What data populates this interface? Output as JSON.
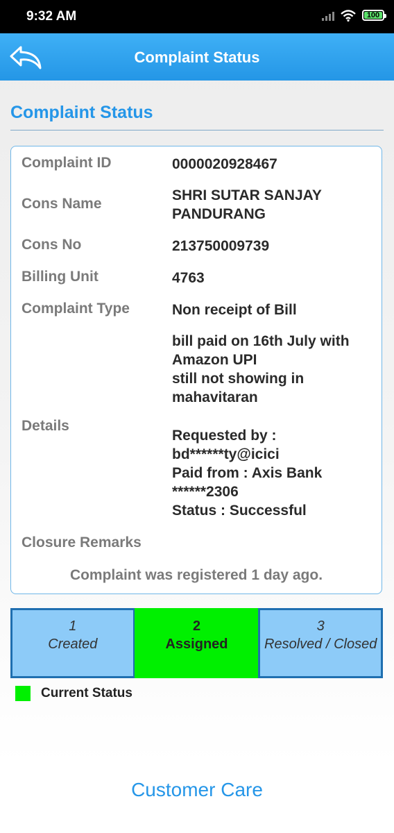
{
  "status_bar": {
    "time": "9:32 AM",
    "battery": "100"
  },
  "app_bar": {
    "title": "Complaint Status",
    "back_icon": "back-arrow-icon"
  },
  "section": {
    "title": "Complaint Status"
  },
  "details": {
    "complaint_id_label": "Complaint ID",
    "complaint_id_value": "0000020928467",
    "cons_name_label": "Cons Name",
    "cons_name_value_line1": "SHRI SUTAR SANJAY",
    "cons_name_value_line2": "PANDURANG",
    "cons_no_label": "Cons No",
    "cons_no_value": "213750009739",
    "billing_unit_label": "Billing Unit",
    "billing_unit_value": "4763",
    "complaint_type_label": "Complaint Type",
    "complaint_type_value": "Non receipt of Bill",
    "details_label": "Details",
    "details_lines": [
      "bill paid on 16th July with",
      "Amazon UPI",
      "still not showing in",
      "mahavitaran",
      "Requested by :",
      "bd******ty@icici",
      "Paid from : Axis Bank",
      "******2306",
      "Status : Successful"
    ],
    "closure_remarks_label": "Closure Remarks",
    "registered_note": "Complaint was registered 1 day ago."
  },
  "progress": {
    "steps": [
      {
        "number": "1",
        "label": "Created"
      },
      {
        "number": "2",
        "label": "Assigned"
      },
      {
        "number": "3",
        "label": "Resolved / Closed"
      }
    ],
    "current_step": 2,
    "legend_label": "Current Status"
  },
  "colors": {
    "accent": "#2596e8",
    "current": "#00f000",
    "pending": "#8dcbf8"
  },
  "footer": {
    "customer_care_label": "Customer Care"
  }
}
